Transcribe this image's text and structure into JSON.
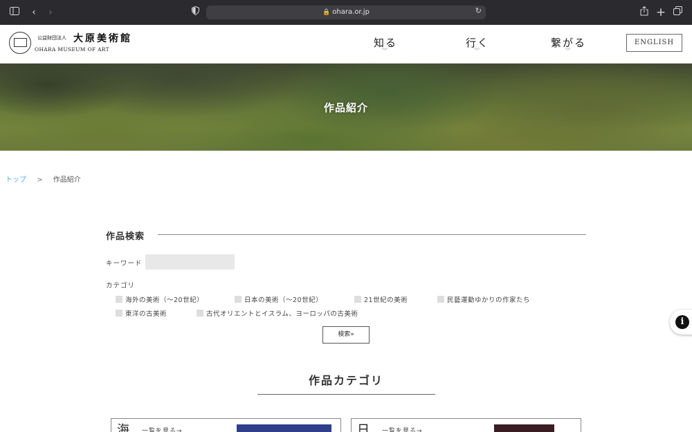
{
  "browser": {
    "url": "ohara.or.jp",
    "icons": {
      "sidebar": "sidebar-icon",
      "back": "back-icon",
      "forward": "forward-icon",
      "privacy": "shield-icon",
      "lock": "lock-icon",
      "reload": "reload-icon",
      "share": "share-icon",
      "new_tab": "plus-icon",
      "tabs": "tabs-icon"
    }
  },
  "header": {
    "logo_small": "公益財団法人",
    "logo_big": "大原美術館",
    "logo_en": "OHARA MUSEUM OF ART",
    "nav": [
      "知る",
      "行く",
      "繋がる"
    ],
    "english": "ENGLISH"
  },
  "hero": {
    "title": "作品紹介"
  },
  "breadcrumb": {
    "home": "トップ",
    "separator": ">",
    "current": "作品紹介"
  },
  "search": {
    "title": "作品検索",
    "keyword_label": "キーワード",
    "keyword_value": "",
    "category_label": "カテゴリ",
    "categories": [
      "海外の美術（〜20世紀）",
      "日本の美術（〜20世紀）",
      "21世紀の美術",
      "民藝運動ゆかりの作家たち",
      "東洋の古美術",
      "古代オリエントとイスラム、ヨーロッパの古美術"
    ],
    "button": "検索»"
  },
  "categories_section": {
    "title": "作品カテゴリ",
    "cards": [
      {
        "initial": "海",
        "link": "一覧を見る→",
        "thumb_color": "#2f3f8a"
      },
      {
        "initial": "日",
        "link": "一覧を見る→",
        "thumb_color": "#3a1d22"
      }
    ]
  },
  "floating": {
    "icon": "info-icon"
  }
}
